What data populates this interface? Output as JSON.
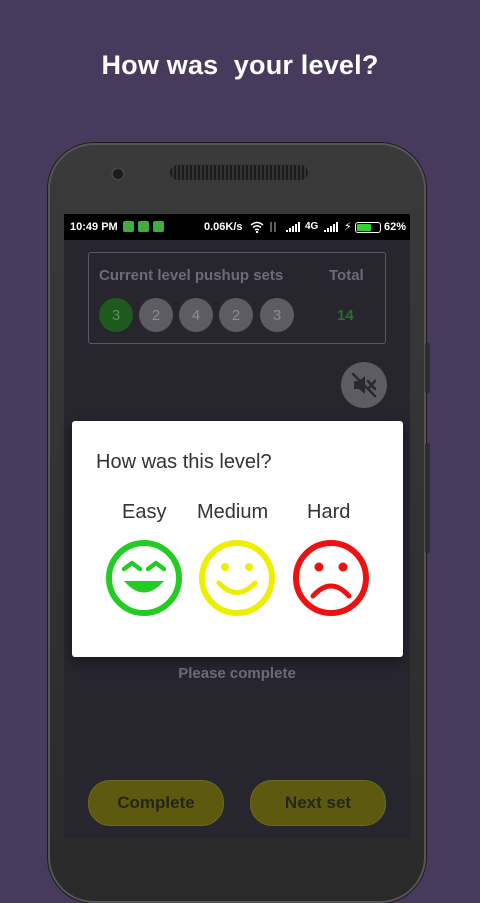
{
  "headline": "How was  your level?",
  "status_bar": {
    "time": "10:49 PM",
    "speed": "0.06K/s",
    "network": "4G",
    "battery_percent": "62%",
    "battery_level": 0.62,
    "battery_color": "#32d232"
  },
  "level_sets": {
    "title": "Current level pushup sets",
    "total_label": "Total",
    "total_value": "14",
    "sets": [
      {
        "reps": "3",
        "completed": true
      },
      {
        "reps": "2",
        "completed": false
      },
      {
        "reps": "4",
        "completed": false
      },
      {
        "reps": "2",
        "completed": false
      },
      {
        "reps": "3",
        "completed": false
      }
    ]
  },
  "mute_icon": "volume-mute-icon",
  "status_message": "Please complete",
  "buttons": {
    "complete": "Complete",
    "next_set": "Next set"
  },
  "dialog": {
    "title": "How was this level?",
    "options": [
      {
        "label": "Easy",
        "icon": "laughing-face-icon",
        "color": "#22cc22"
      },
      {
        "label": "Medium",
        "icon": "smiling-face-icon",
        "color": "#eeee00"
      },
      {
        "label": "Hard",
        "icon": "sad-face-icon",
        "color": "#ee1111"
      }
    ]
  },
  "colors": {
    "background": "#473a5c",
    "button_yellow": "#5d5a10",
    "set_done": "#1e5a1e"
  }
}
